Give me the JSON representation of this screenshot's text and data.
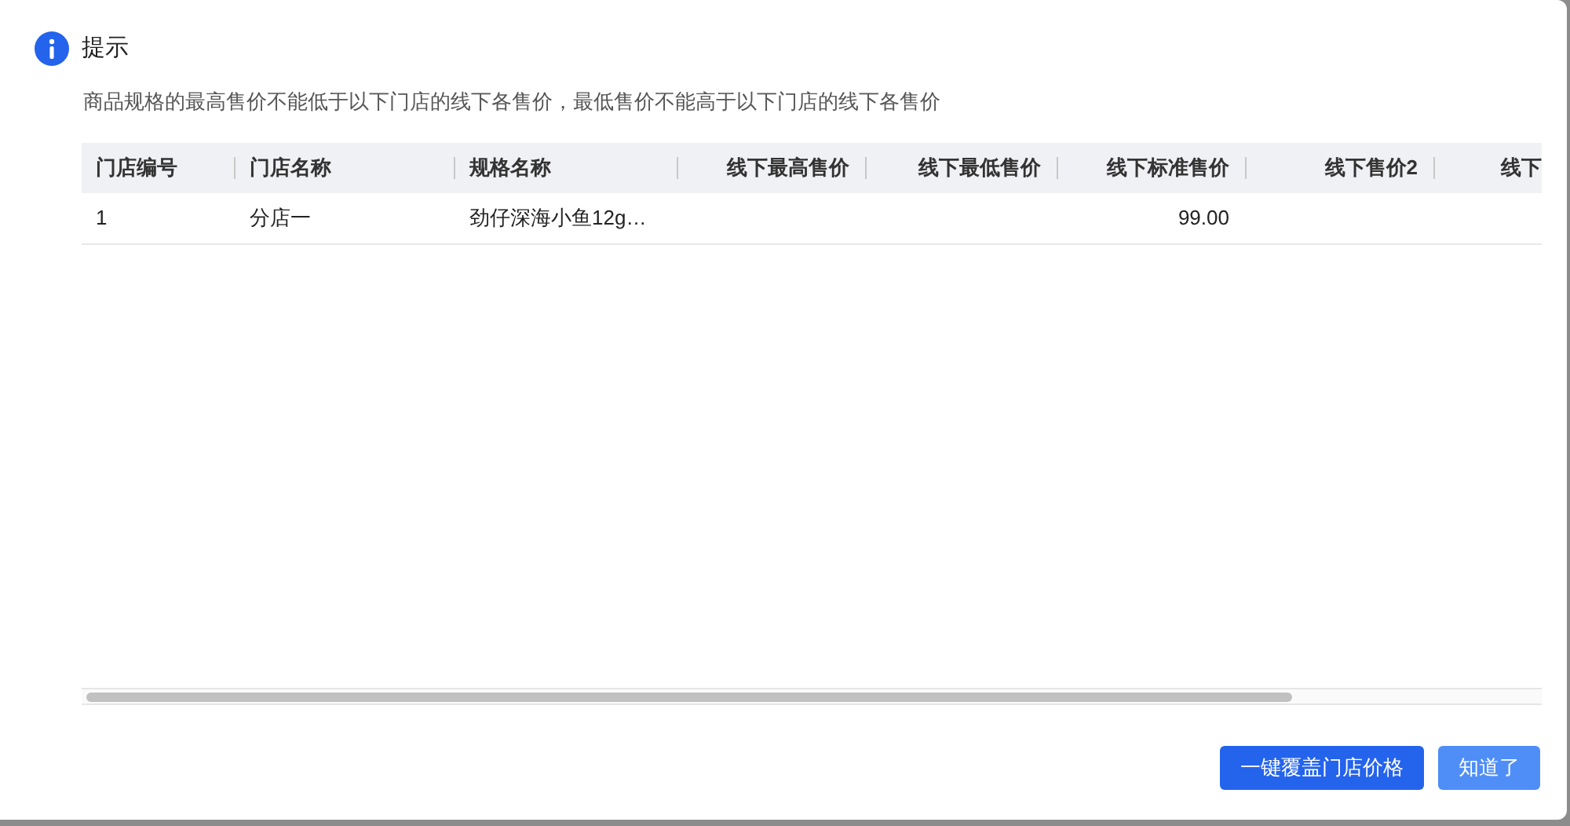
{
  "dialog": {
    "title": "提示",
    "message": "商品规格的最高售价不能低于以下门店的线下各售价，最低售价不能高于以下门店的线下各售价"
  },
  "table": {
    "columns": [
      "门店编号",
      "门店名称",
      "规格名称",
      "线下最高售价",
      "线下最低售价",
      "线下标准售价",
      "线下售价2",
      "线下"
    ],
    "rows": [
      {
        "cells": [
          "1",
          "分店一",
          "劲仔深海小鱼12g…",
          null,
          null,
          "99.00",
          null,
          null
        ]
      }
    ]
  },
  "buttons": [
    {
      "label": "一键覆盖门店价格",
      "kind": "primary"
    },
    {
      "label": "知道了",
      "kind": "secondary"
    }
  ]
}
